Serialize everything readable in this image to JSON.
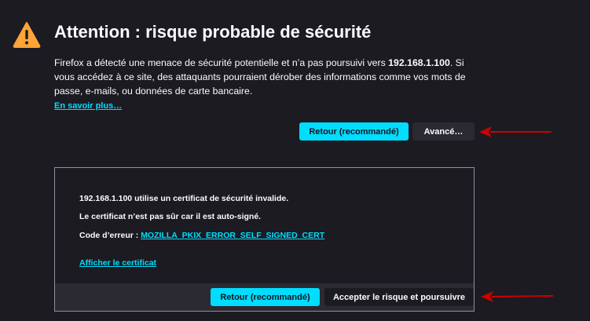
{
  "header": {
    "title": "Attention : risque probable de sécurité",
    "icon": "warning-triangle-icon",
    "icon_color": "#ffa436"
  },
  "description": {
    "part1": "Firefox a détecté une menace de sécurité potentielle et n’a pas poursuivi vers ",
    "host": "192.168.1.100",
    "part2": ". Si vous accédez à ce site, des attaquants pourraient dérober des informations comme vos mots de passe, e-mails, ou données de carte bancaire."
  },
  "learn_more": "En savoir plus…",
  "buttons": {
    "back": "Retour (recommandé)",
    "advanced": "Avancé…",
    "accept": "Accepter le risque et poursuivre"
  },
  "advanced_panel": {
    "invalid_cert": "192.168.1.100 utilise un certificat de sécurité invalide.",
    "self_signed": "Le certificat n’est pas sûr car il est auto-signé.",
    "error_code_label": "Code d’erreur : ",
    "error_code": "MOZILLA_PKIX_ERROR_SELF_SIGNED_CERT",
    "view_certificate": "Afficher le certificat"
  },
  "annotations": {
    "arrow_color": "#cc0000"
  },
  "colors": {
    "background": "#1c1b22",
    "accent": "#00ddff",
    "text": "#fbfbfe"
  }
}
